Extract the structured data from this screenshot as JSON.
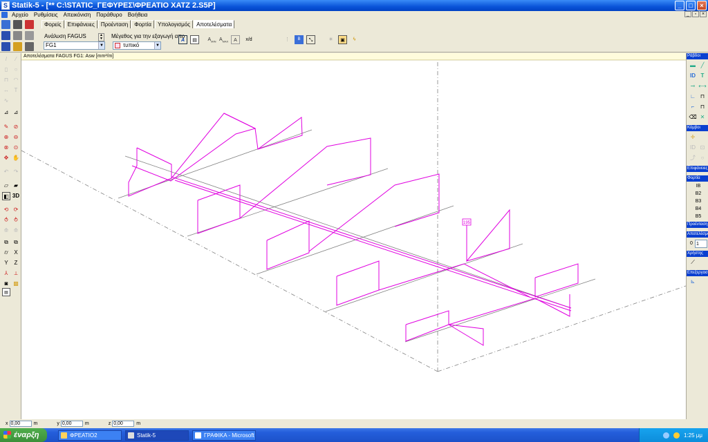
{
  "window": {
    "title": "Statik-5 - [** C:\\STATIC_ΓΕΦΥΡΕΣ\\ΦΡΕΑΤΙΟ ΧΑΤΖ 2.S5P]",
    "minimize": "_",
    "maximize": "□",
    "close": "×"
  },
  "menu": [
    "Αρχείο",
    "Ρυθμίσεις",
    "Απεικόνιση",
    "Παράθυρο",
    "Βοήθεια"
  ],
  "tabs": [
    {
      "label": "Φορείς",
      "active": false
    },
    {
      "label": "Επιφάνειες",
      "active": false
    },
    {
      "label": "Προένταση",
      "active": false
    },
    {
      "label": "Φορτία",
      "active": false
    },
    {
      "label": "Υπολογισμός",
      "active": false
    },
    {
      "label": "Αποτελέσματα",
      "active": true
    }
  ],
  "toolbar": {
    "analysis_label": "Ανάλυση FAGUS",
    "analysis_value": "FG1",
    "size_label": "Μέγεθος για την εξαγωγή απο",
    "size_value": "τυπικό",
    "xd_label": "x/d",
    "a_min": "MIN",
    "a_max": "MAX"
  },
  "info": {
    "text": "Αποτελέσματα FAGUS FG1:  Asw [mm²/m]"
  },
  "left_toolbar": {
    "three_d": "3D",
    "x": "X",
    "y": "Y",
    "z": "Z"
  },
  "right_panel": {
    "sections": [
      {
        "label": "Ράβδοι"
      },
      {
        "label": "Κόμβοι"
      },
      {
        "label": "Επιφάνειες"
      },
      {
        "label": "Φορτία"
      },
      {
        "label": "Προένταση"
      },
      {
        "label": "Αποτελέσματα"
      },
      {
        "label": "Χρήστης"
      },
      {
        "label": "Επεξεργασία"
      }
    ],
    "loads": [
      "IB",
      "B2",
      "B3",
      "B4",
      "B5"
    ],
    "result_values": [
      "0",
      "1"
    ]
  },
  "canvas": {
    "value_label": "195"
  },
  "coords": {
    "x_label": "x",
    "x_value": "0,00",
    "x_unit": "m",
    "y_label": "y",
    "y_value": "0,00",
    "y_unit": "m",
    "z_label": "z",
    "z_value": "0,00",
    "z_unit": "m"
  },
  "taskbar": {
    "start": "έναρξη",
    "tasks": [
      {
        "label": "ΦΡΕΑΤΙΟ2",
        "active": false
      },
      {
        "label": "Statik-5",
        "active": true
      },
      {
        "label": "ΓΡΑΦΙΚΑ - Microsoft ...",
        "active": false
      }
    ],
    "clock": "1:25 μμ"
  },
  "colors": {
    "result_lines": "#e000e0",
    "structure_lines": "#808080",
    "title_blue": "#0a53d8"
  }
}
